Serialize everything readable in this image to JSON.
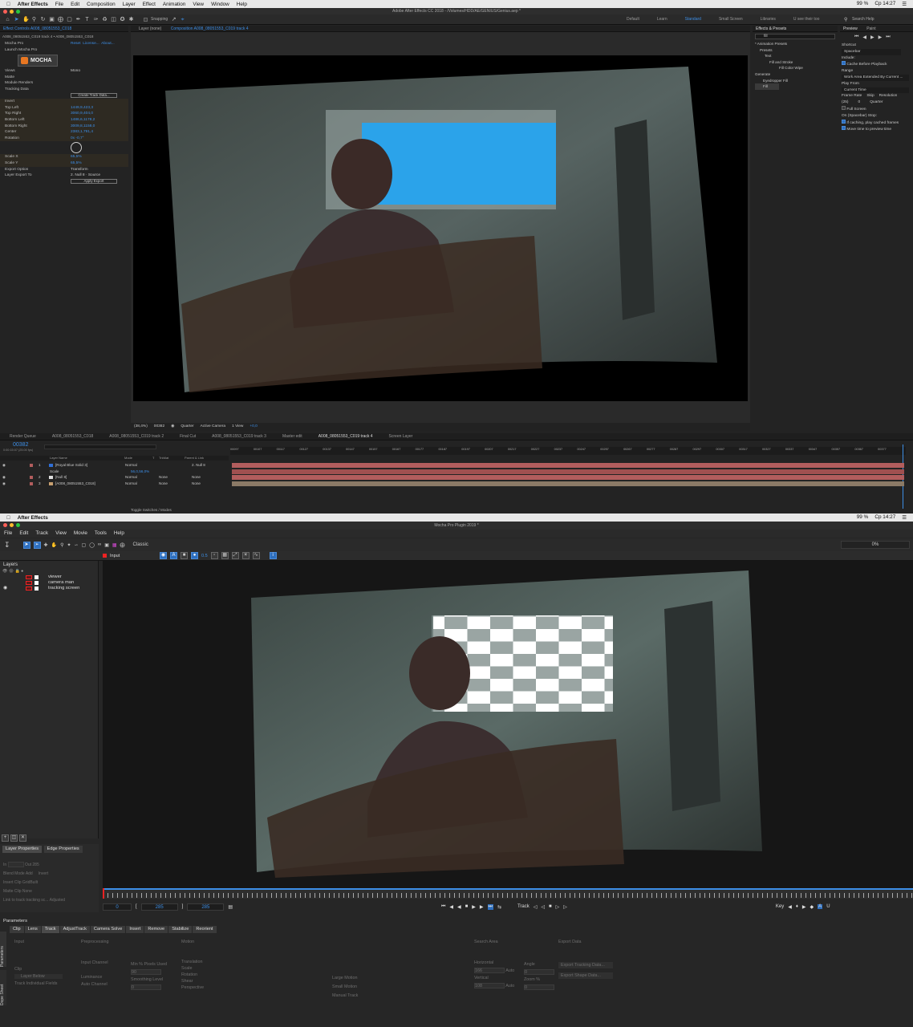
{
  "ae": {
    "app_name": "After Effects",
    "menus": [
      "File",
      "Edit",
      "Composition",
      "Layer",
      "Effect",
      "Animation",
      "View",
      "Window",
      "Help"
    ],
    "status": {
      "battery": "99 %",
      "clock": "Cp 14:27"
    },
    "window_title": "Adobe After Effects CC 2018 - /Volumes/HDD/AE/GENIUS/Genius.aep *",
    "snapping": "Snapping",
    "workspaces": [
      "Default",
      "Learn",
      "Standard",
      "Small Screen",
      "Libraries",
      "U see their too"
    ],
    "active_workspace": "Standard",
    "search_help": "Search Help",
    "effect_controls": {
      "tab_label": "Effect Controls A008_08051553_C018",
      "breadcrumb": "A008_08051553_C019 track 4 • A008_08051553_C018",
      "effect_name": "Mocha Pro",
      "links": [
        "Reset",
        "License...",
        "About..."
      ],
      "launch": "Launch Mocha Pro",
      "logo": "MOCHA",
      "rows": [
        {
          "label": "Views",
          "value": "Mono"
        },
        {
          "label": "Matte",
          "value": ""
        },
        {
          "label": "Module Renders",
          "value": ""
        },
        {
          "label": "Tracking Data",
          "value": ""
        },
        {
          "label": "",
          "value": "Create Track Data..."
        },
        {
          "label": "Invert",
          "value": ""
        },
        {
          "label": "Top Left",
          "value": "1449,9,423,3"
        },
        {
          "label": "Top Right",
          "value": "3060,9,404,0"
        },
        {
          "label": "Bottom Left",
          "value": "1486,6,1178,2"
        },
        {
          "label": "Bottom Right",
          "value": "3009,8,1158,0"
        },
        {
          "label": "Center",
          "value": "2383,1,791,4"
        },
        {
          "label": "Rotation",
          "value": "0x -0,7°"
        },
        {
          "label": "Scale X",
          "value": "65,5%"
        },
        {
          "label": "Scale Y",
          "value": "65,5%"
        },
        {
          "label": "Export Option",
          "value": "Transform"
        },
        {
          "label": "Layer Export To",
          "value": "2. Null 8 · Source"
        },
        {
          "label": "",
          "value": "Apply Export"
        }
      ]
    },
    "viewer_tabs": [
      "Layer (none)",
      "Composition A008_08051553_C019 track 4"
    ],
    "viewer_bottom": {
      "zoom": "(38,4%)",
      "frame": "00382",
      "res": "Quarter",
      "camera": "Active Camera",
      "view": "1 View",
      "offset": "+0,0"
    },
    "effects_presets": {
      "title": "Effects & Presets",
      "search": "fill",
      "tree": [
        "* Animation Presets",
        "Presets",
        "Text",
        "Fill and Stroke",
        "Fill Color Wipe",
        "Generate",
        "Eyedropper Fill",
        "Fill"
      ]
    },
    "preview": {
      "tabs": [
        "Preview",
        "Paint"
      ],
      "shortcut_label": "Shortcut",
      "shortcut": "Spacebar",
      "include": "Include:",
      "cache": "Cache Before Playback",
      "range_label": "Range",
      "range": "Work Area Extended By Current ...",
      "play_from_label": "Play From",
      "play_from": "Current Time",
      "frame_rate_label": "Frame Rate",
      "skip_label": "Skip",
      "resolution_label": "Resolution",
      "frame_rate": "(25)",
      "skip": "0",
      "resolution": "Quarter",
      "full_screen": "Full Screen",
      "on_stop": "On (Spacebar) Stop:",
      "if_caching": "If caching, play cached frames",
      "move_time": "Move time to preview time"
    },
    "timeline_tabs": [
      "Render Queue",
      "A008_08051553_C018",
      "A008_08051553_C019 track 2",
      "Final Cut",
      "A008_08051553_C019 track 3",
      "Master edit",
      "A008_08051553_C019 track 4",
      "Screen Layer"
    ],
    "timecode": "00382",
    "timecode_sub": "0:00:15:07 (25.00 fps)",
    "columns": [
      "Layer Name",
      "Mode",
      "T",
      "TrkMat",
      "Parent & Link"
    ],
    "ruler": [
      "00097",
      "00107",
      "00117",
      "00127",
      "00137",
      "00147",
      "00157",
      "00167",
      "00177",
      "00187",
      "00197",
      "00207",
      "00217",
      "00227",
      "00237",
      "00247",
      "00257",
      "00267",
      "00277",
      "00287",
      "00297",
      "00307",
      "00317",
      "00327",
      "00337",
      "00347",
      "00357",
      "00367",
      "00377"
    ],
    "layers": [
      {
        "num": "1",
        "name": "[Royal Blue Solid 3]",
        "mode": "Normal",
        "trk": "",
        "parent": "2. Null 8",
        "color": "#2f6fd6"
      },
      {
        "num": "",
        "name": "Scale",
        "mode": "",
        "trk": "",
        "parent": "",
        "value": "56,0,56,0%"
      },
      {
        "num": "2",
        "name": "[Null 8]",
        "mode": "Normal",
        "trk": "None",
        "parent": "None",
        "color": "#e0e0e0"
      },
      {
        "num": "3",
        "name": "[A008_08051553_C018]",
        "mode": "Normal",
        "trk": "None",
        "parent": "None",
        "color": "#c8a070"
      }
    ],
    "toggle": "Toggle Switches / Modes"
  },
  "mocha": {
    "app_name": "After Effects",
    "window_title": "Mocha Pro Plugin 2019 *",
    "menus": [
      "File",
      "Edit",
      "Track",
      "View",
      "Movie",
      "Tools",
      "Help"
    ],
    "view_mode": "Classic",
    "progress": "0%",
    "layers_title": "Layers",
    "clip": "Input",
    "layers": [
      "viewer",
      "camera man",
      "tracking screen"
    ],
    "props_tabs": [
      "Layer Properties",
      "Edge Properties"
    ],
    "props": {
      "in_label": "In",
      "out_label": "Out",
      "out_value": "285",
      "blend_label": "Blend Mode",
      "blend": "Add",
      "invert": "Invert",
      "insert_clip_label": "Insert Clip",
      "insert_clip": "GridBuilt",
      "matte_clip_label": "Matte Clip",
      "matte_clip": "None",
      "link_label": "Link to track",
      "link": "tracking sc...",
      "adjusted": "Adjusted"
    },
    "transport": {
      "start": "0",
      "in": "285",
      "out": "285",
      "track": "Track",
      "key": "Key"
    },
    "params_title": "Parameters",
    "param_tabs": [
      "Clip",
      "Lens",
      "Track",
      "AdjustTrack",
      "Camera Solve",
      "Insert",
      "Remove",
      "Stabilize",
      "Reorient"
    ],
    "active_param_tab": "Track",
    "side_tabs": [
      "Parameters",
      "Dope Sheet"
    ],
    "sections": {
      "input": "Input",
      "preprocessing": "Preprocessing",
      "motion": "Motion",
      "search_area": "Search Area",
      "export_data": "Export Data",
      "clip": "Clip",
      "layer_below": "Layer Below",
      "track_fields": "Track Individual Fields",
      "input_channel": "Input Channel",
      "luminance": "Luminance",
      "auto_channel": "Auto Channel",
      "min_pixels": "Min % Pixels Used",
      "min_val": "90",
      "smoothing": "Smoothing Level",
      "smooth_val": "0",
      "motions": [
        "Translation",
        "Scale",
        "Rotation",
        "Shear",
        "Perspective"
      ],
      "motion_types": [
        "Large Motion",
        "Small Motion",
        "Manual Track"
      ],
      "horizontal": "Horizontal",
      "h_val": "166",
      "vertical": "Vertical",
      "v_val": "108",
      "auto": "Auto",
      "angle": "Angle",
      "angle_val": "0",
      "zoom": "Zoom %",
      "zoom_val": "0",
      "export_tracking": "Export Tracking Data...",
      "export_shape": "Export Shape Data..."
    }
  }
}
